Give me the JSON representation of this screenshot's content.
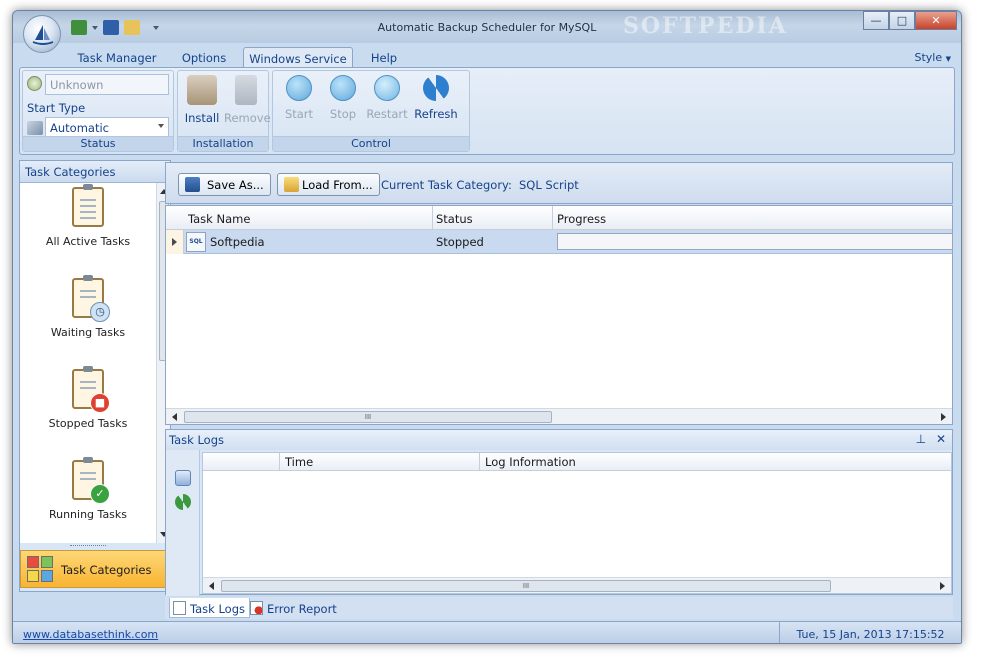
{
  "window": {
    "title": "Automatic Backup Scheduler for MySQL",
    "watermark": "SOFTPEDIA",
    "controls": {
      "minimize": "—",
      "maximize": "□",
      "close": "✕"
    }
  },
  "tabs": [
    {
      "label": "Task Manager"
    },
    {
      "label": "Options"
    },
    {
      "label": "Windows Service"
    },
    {
      "label": "Help"
    }
  ],
  "style_menu": "Style",
  "ribbon": {
    "status": {
      "service_value": "Unknown",
      "start_type_label": "Start Type",
      "start_type_value": "Automatic",
      "group_label": "Status"
    },
    "installation": {
      "install": "Install",
      "remove": "Remove",
      "group_label": "Installation"
    },
    "control": {
      "start": "Start",
      "stop": "Stop",
      "restart": "Restart",
      "refresh": "Refresh",
      "group_label": "Control"
    }
  },
  "nav": {
    "header": "Task Categories",
    "items": [
      {
        "label": "All Active Tasks"
      },
      {
        "label": "Waiting Tasks"
      },
      {
        "label": "Stopped Tasks"
      },
      {
        "label": "Running Tasks"
      }
    ],
    "selected_label": "Task Categories"
  },
  "toolbar": {
    "save_as": "Save As...",
    "load_from": "Load From...",
    "category_label": "Current Task Category:",
    "category_value": "SQL Script"
  },
  "grid": {
    "columns": [
      "Task Name",
      "Status",
      "Progress"
    ],
    "rows": [
      {
        "name": "Softpedia",
        "status": "Stopped",
        "icon": "sql-script-icon"
      }
    ],
    "sql_icon_text": "SQL"
  },
  "logs": {
    "title": "Task Logs",
    "columns": [
      "Time",
      "Log Information"
    ]
  },
  "bottom_tabs": [
    {
      "label": "Task Logs"
    },
    {
      "label": "Error Report"
    }
  ],
  "statusbar": {
    "link": "www.databasethink.com",
    "datetime": "Tue, 15 Jan, 2013 17:15:52"
  },
  "scrollbar_grip": "III",
  "colors": {
    "accent_selected": "#f9b431",
    "ribbon_text": "#15428b",
    "row_selected": "#c8d9f0"
  }
}
